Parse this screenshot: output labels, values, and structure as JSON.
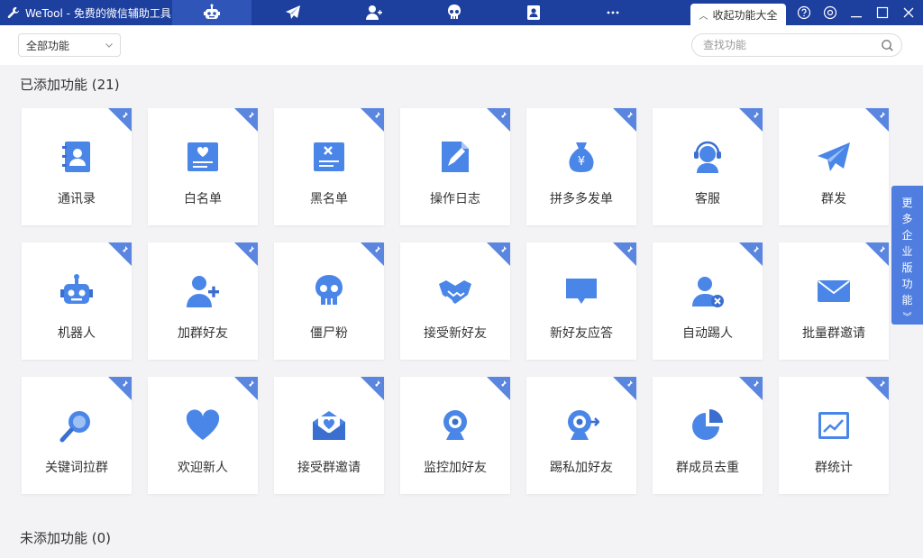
{
  "app": {
    "title": "WeTool - 免费的微信辅助工具"
  },
  "nav_tabs": [
    {
      "icon": "robot-icon",
      "active": true
    },
    {
      "icon": "paper-plane-icon",
      "active": false
    },
    {
      "icon": "add-user-icon",
      "active": false
    },
    {
      "icon": "skull-icon",
      "active": false
    },
    {
      "icon": "contact-card-icon",
      "active": false
    },
    {
      "icon": "more-icon",
      "active": false
    }
  ],
  "collapse_tab": {
    "label": "收起功能大全"
  },
  "window_buttons": [
    "help-icon",
    "settings-icon",
    "minimize-icon",
    "maximize-icon",
    "close-icon"
  ],
  "filter": {
    "value": "全部功能"
  },
  "search": {
    "placeholder": "查找功能",
    "value": ""
  },
  "added_section": {
    "title": "已添加功能 (21)"
  },
  "not_added_section": {
    "title": "未添加功能 (0)"
  },
  "features": [
    {
      "label": "通讯录",
      "icon": "contacts-book-icon"
    },
    {
      "label": "白名单",
      "icon": "whitelist-icon"
    },
    {
      "label": "黑名单",
      "icon": "blacklist-icon"
    },
    {
      "label": "操作日志",
      "icon": "operation-log-icon"
    },
    {
      "label": "拼多多发单",
      "icon": "money-bag-icon"
    },
    {
      "label": "客服",
      "icon": "customer-service-icon"
    },
    {
      "label": "群发",
      "icon": "paper-plane-icon"
    },
    {
      "label": "机器人",
      "icon": "robot-icon"
    },
    {
      "label": "加群好友",
      "icon": "add-user-icon"
    },
    {
      "label": "僵尸粉",
      "icon": "skull-icon"
    },
    {
      "label": "接受新好友",
      "icon": "handshake-icon"
    },
    {
      "label": "新好友应答",
      "icon": "chat-bubble-icon"
    },
    {
      "label": "自动踢人",
      "icon": "remove-user-icon"
    },
    {
      "label": "批量群邀请",
      "icon": "envelope-icon"
    },
    {
      "label": "关键词拉群",
      "icon": "magnifier-icon"
    },
    {
      "label": "欢迎新人",
      "icon": "heart-icon"
    },
    {
      "label": "接受群邀请",
      "icon": "open-envelope-heart-icon"
    },
    {
      "label": "监控加好友",
      "icon": "webcam-icon"
    },
    {
      "label": "踢私加好友",
      "icon": "webcam-kick-icon"
    },
    {
      "label": "群成员去重",
      "icon": "pie-chart-icon"
    },
    {
      "label": "群统计",
      "icon": "line-chart-icon"
    }
  ],
  "side_tab": {
    "label": "更多企业版功能"
  },
  "colors": {
    "titlebar": "#1d3f9e",
    "accent": "#4a86e8",
    "corner": "#5a86e0",
    "background": "#f3f3f5"
  }
}
